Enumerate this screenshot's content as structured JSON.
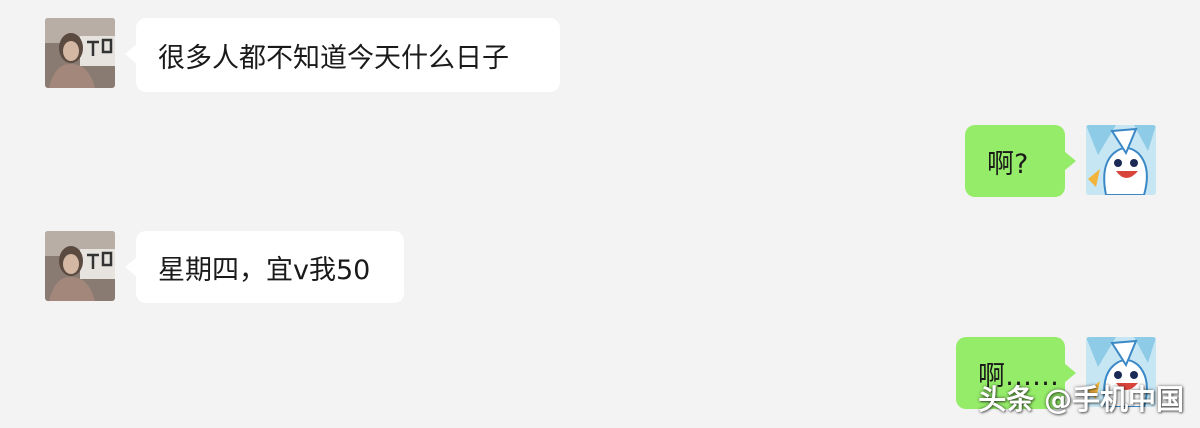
{
  "messages": [
    {
      "side": "received",
      "text": "很多人都不知道今天什么日子",
      "avatar": "photo-avatar"
    },
    {
      "side": "sent",
      "text": "啊?",
      "avatar": "cartoon-avatar"
    },
    {
      "side": "received",
      "text": "星期四，宜v我50",
      "avatar": "photo-avatar"
    },
    {
      "side": "sent",
      "text": "啊……",
      "avatar": "cartoon-avatar"
    }
  ],
  "watermark": "头条 @手机中国",
  "colors": {
    "background": "#f3f3f3",
    "received_bubble": "#ffffff",
    "sent_bubble": "#95ec69"
  }
}
